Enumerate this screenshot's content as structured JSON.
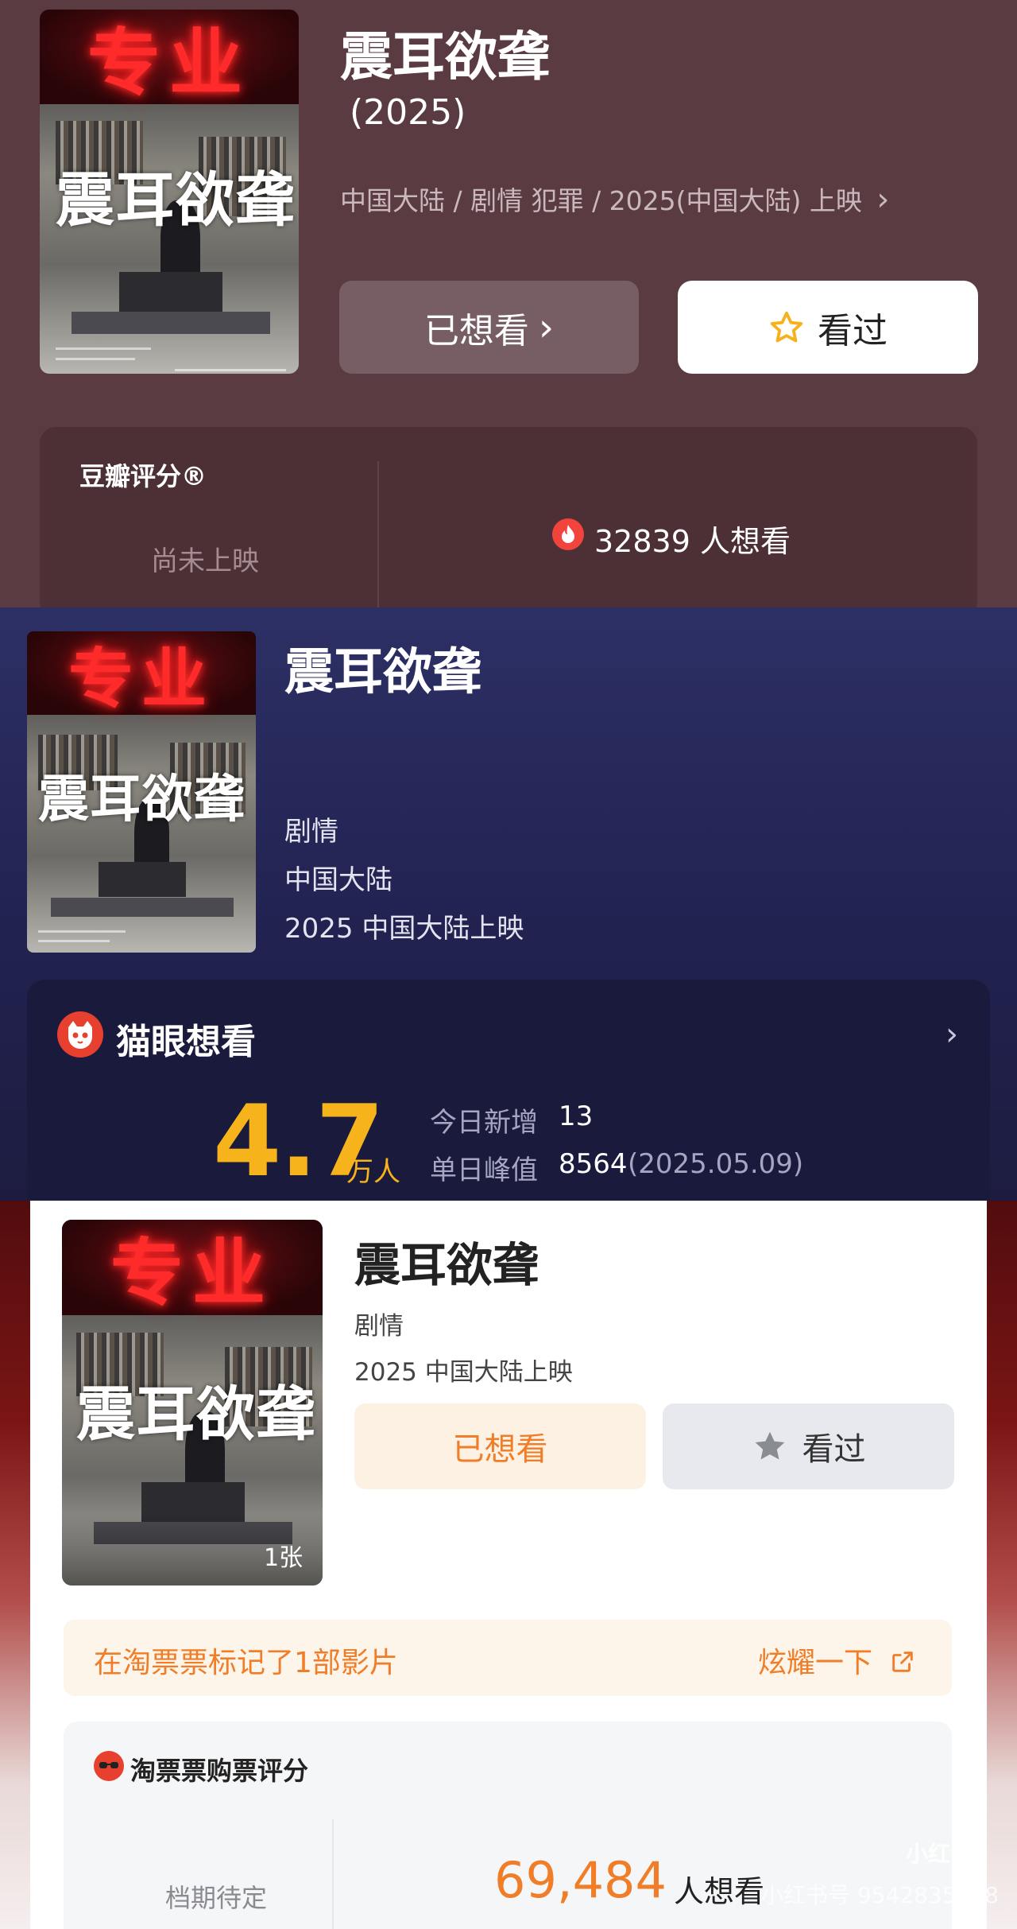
{
  "douban": {
    "title": "震耳欲聋",
    "year": "(2025)",
    "meta": "中国大陆 / 剧情 犯罪 / 2025(中国大陆) 上映",
    "meta_arrow": "›",
    "want_button": "已想看",
    "want_arrow": "›",
    "seen_button": "看过",
    "rating_title": "豆瓣评分®",
    "rating_status": "尚未上映",
    "want_count": "32839 人想看"
  },
  "maoyan": {
    "title": "震耳欲聋",
    "genre": "剧情",
    "region": "中国大陆",
    "release": "2025 中国大陆上映",
    "card_title": "猫眼想看",
    "card_arrow": "›",
    "want_value": "4.7",
    "want_unit": "万人",
    "today_label": "今日新增",
    "today_value": "13",
    "peak_label": "单日峰值",
    "peak_value": "8564",
    "peak_date": "(2025.05.09)"
  },
  "taopiaopiao": {
    "title": "震耳欲聋",
    "genre": "剧情",
    "release": "2025 中国大陆上映",
    "want_button": "已想看",
    "seen_button": "看过",
    "photo_count": "1张",
    "mark_text": "在淘票票标记了1部影片",
    "show_off": "炫耀一下",
    "rating_title": "淘票票购票评分",
    "rating_status": "档期待定",
    "want_number": "69,484",
    "want_unit": "人想看",
    "watermark_logo": "小红书",
    "watermark_id": "小红书号 9542835038"
  },
  "poster": {
    "sign_text": "专业",
    "title_text": "震耳欲聋"
  },
  "colors": {
    "douban_bg": "#5a3b42",
    "maoyan_bg": "#2d3065",
    "maoyan_accent": "#f6b31b",
    "taopiaopiao_accent": "#f07d27",
    "star_yellow": "#f5b21c",
    "flame_red": "#f2433c"
  },
  "icons": [
    "star-icon",
    "flame-icon",
    "cat-logo-icon",
    "chevron-right-icon",
    "share-icon",
    "taopiaopiao-logo-icon"
  ]
}
